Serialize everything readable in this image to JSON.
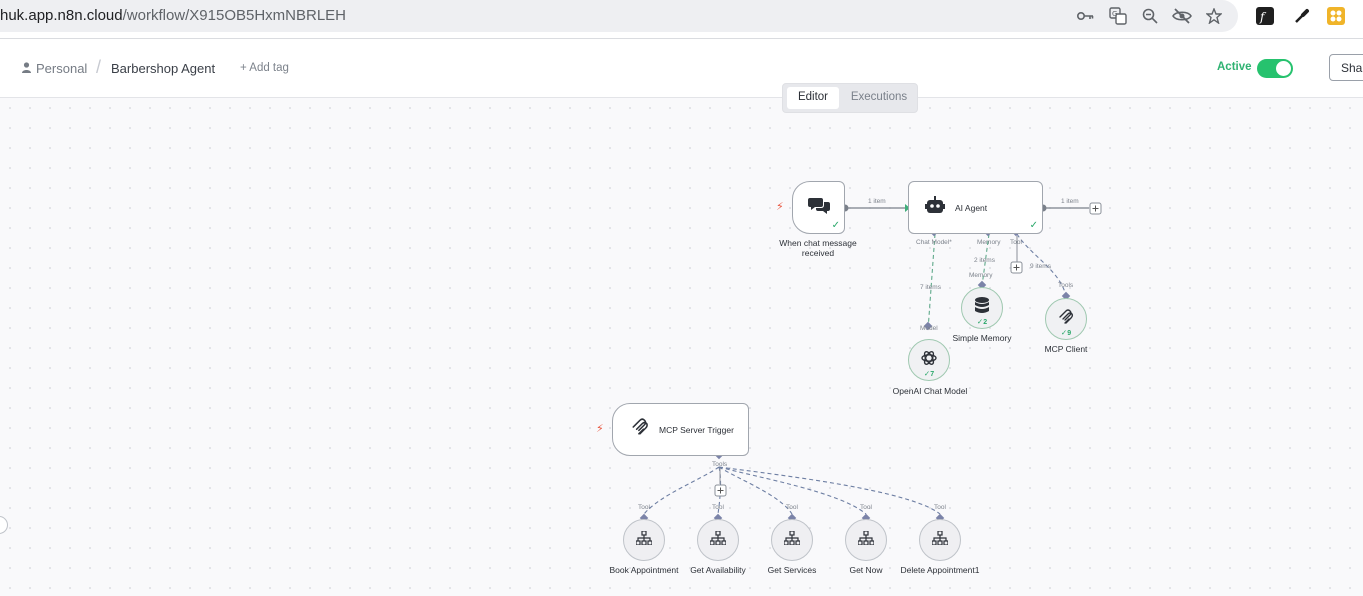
{
  "browser": {
    "url_host": "huk.app.n8n.cloud",
    "url_path": "/workflow/X915OB5HxmNBRLEH"
  },
  "header": {
    "breadcrumb_personal": "Personal",
    "workflow_title": "Barbershop Agent",
    "add_tag": "+ Add tag",
    "active_label": "Active",
    "active": true,
    "share_label": "Shar"
  },
  "tabs": {
    "editor": "Editor",
    "executions": "Executions",
    "selected": "Editor"
  },
  "nodes": {
    "chat_trigger": {
      "label": "When chat message received"
    },
    "ai_agent": {
      "label": "AI Agent"
    },
    "openai_model": {
      "label": "OpenAI Chat Model",
      "count": "7"
    },
    "simple_memory": {
      "label": "Simple Memory",
      "count": "2"
    },
    "mcp_client": {
      "label": "MCP Client",
      "count": "9"
    },
    "mcp_server_trigger": {
      "label": "MCP Server Trigger"
    },
    "book_appointment": {
      "label": "Book Appointment"
    },
    "get_availability": {
      "label": "Get Availability"
    },
    "get_services": {
      "label": "Get Services"
    },
    "get_now": {
      "label": "Get Now"
    },
    "delete_appointment": {
      "label": "Delete Appointment1"
    }
  },
  "edge_labels": {
    "chat_to_agent": "1 item",
    "agent_out": "1 item",
    "chat_model_port": "Chat Model*",
    "memory_port": "Memory",
    "tool_port": "Tool",
    "model_items": "7 items",
    "memory_items": "2 items",
    "tool_items": "9 items",
    "model_in": "Model",
    "memory_in": "Memory",
    "tools_in": "Tools",
    "server_tools_port": "Tools",
    "tool_in": "Tool"
  },
  "colors": {
    "accent_green": "#26c26e",
    "edge_dashed": "#6e7fa3",
    "trigger_bolt": "#e8563f"
  }
}
